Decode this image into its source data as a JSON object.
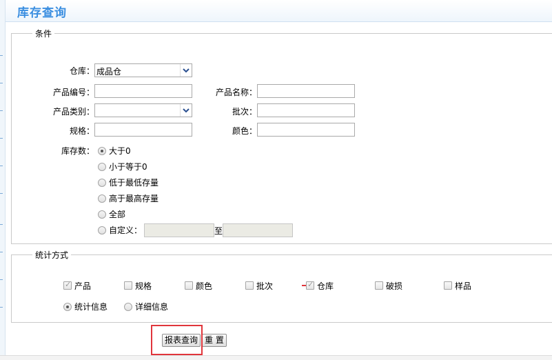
{
  "page": {
    "title": "库存查询"
  },
  "conditions": {
    "legend": "条件",
    "warehouse": {
      "label": "仓库：",
      "value": "成品仓"
    },
    "product_code": {
      "label": "产品编号：",
      "value": ""
    },
    "product_name": {
      "label": "产品名称：",
      "value": ""
    },
    "product_category": {
      "label": "产品类别：",
      "value": ""
    },
    "batch": {
      "label": "批次：",
      "value": ""
    },
    "spec": {
      "label": "规格：",
      "value": ""
    },
    "color": {
      "label": "颜色：",
      "value": ""
    },
    "stock_qty": {
      "label": "库存数：",
      "options": [
        "大于0",
        "小于等于0",
        "低于最低存量",
        "高于最高存量",
        "全部",
        "自定义："
      ],
      "selected": "大于0",
      "custom_to": "至"
    }
  },
  "stats": {
    "legend": "统计方式",
    "checkboxes": [
      {
        "label": "产品",
        "checked": true,
        "disabled": true
      },
      {
        "label": "规格",
        "checked": false
      },
      {
        "label": "颜色",
        "checked": false
      },
      {
        "label": "批次",
        "checked": false
      },
      {
        "label": "仓库",
        "checked": true,
        "disabled": true
      },
      {
        "label": "破损",
        "checked": false
      },
      {
        "label": "样品",
        "checked": false
      }
    ],
    "modes": [
      "统计信息",
      "详细信息"
    ],
    "selected_mode": "统计信息"
  },
  "actions": {
    "query": "报表查询",
    "reset": "重 置"
  },
  "colors": {
    "title": "#3a8ee0",
    "highlight": "#e0353b"
  }
}
